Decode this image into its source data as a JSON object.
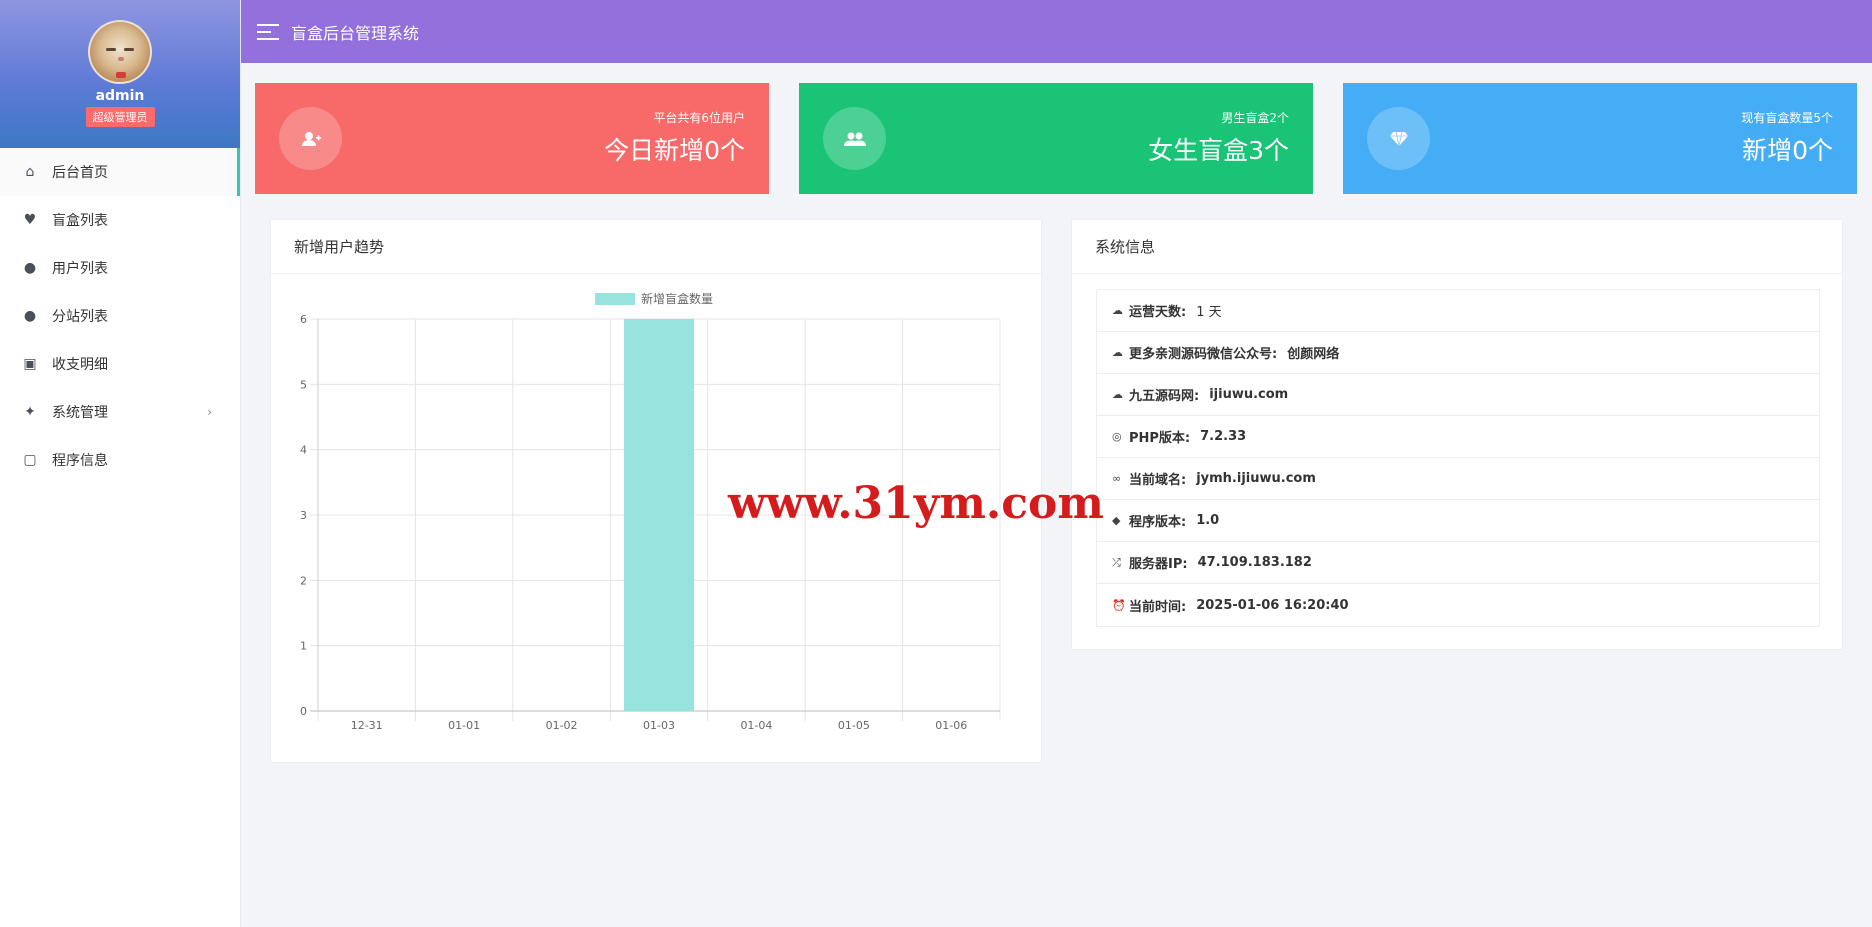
{
  "sidebar": {
    "user_name": "admin",
    "role_badge": "超级管理员",
    "items": [
      {
        "label": "后台首页",
        "icon": "home-icon",
        "glyph": "⌂",
        "active": true
      },
      {
        "label": "盲盒列表",
        "icon": "heart-icon",
        "glyph": "♥"
      },
      {
        "label": "用户列表",
        "icon": "user-icon",
        "glyph": "●"
      },
      {
        "label": "分站列表",
        "icon": "user-icon",
        "glyph": "●"
      },
      {
        "label": "收支明细",
        "icon": "contacts-book-icon",
        "glyph": "▣"
      },
      {
        "label": "系统管理",
        "icon": "sparkles-icon",
        "glyph": "✦",
        "has_submenu": true
      },
      {
        "label": "程序信息",
        "icon": "terminal-icon",
        "glyph": "▢"
      }
    ],
    "submenu_arrow": "›"
  },
  "header": {
    "title": "盲盒后台管理系统",
    "bg_color": "#9370db"
  },
  "cards": [
    {
      "small": "平台共有6位用户",
      "big": "今日新增0个",
      "icon": "user-plus-icon",
      "color": "#f86a6a"
    },
    {
      "small": "男生盲盒2个",
      "big": "女生盲盒3个",
      "icon": "users-icon",
      "color": "#1bc377"
    },
    {
      "small": "现有盲盒数量5个",
      "big": "新增0个",
      "icon": "diamond-icon",
      "color": "#45adf5"
    }
  ],
  "chart_panel": {
    "title": "新增用户趋势"
  },
  "chart_data": {
    "type": "bar",
    "categories": [
      "12-31",
      "01-01",
      "01-02",
      "01-03",
      "01-04",
      "01-05",
      "01-06"
    ],
    "series": [
      {
        "name": "新增盲盒数量",
        "values": [
          0,
          0,
          0,
          6,
          0,
          0,
          0
        ],
        "color": "#98e3dd"
      }
    ],
    "ylim": [
      0,
      6
    ],
    "yticks": [
      0,
      1,
      2,
      3,
      4,
      5,
      6
    ],
    "legend": "top-center",
    "grid": true
  },
  "info_panel": {
    "title": "系统信息",
    "rows": [
      {
        "icon": "cloud-icon",
        "glyph": "☁",
        "label": "运营天数:",
        "value": "1 天",
        "light": true
      },
      {
        "icon": "cloud-icon",
        "glyph": "☁",
        "label": "更多亲测源码微信公众号:",
        "value": "创颜网络"
      },
      {
        "icon": "cloud-icon",
        "glyph": "☁",
        "label": "九五源码网:",
        "value": "ijiuwu.com"
      },
      {
        "icon": "php-icon",
        "glyph": "◎",
        "label": "PHP版本:",
        "value": "7.2.33"
      },
      {
        "icon": "link-icon",
        "glyph": "∞",
        "label": "当前域名:",
        "value": "jymh.ijiuwu.com"
      },
      {
        "icon": "code-icon",
        "glyph": "◆",
        "label": "程序版本:",
        "value": "1.0"
      },
      {
        "icon": "shuffle-icon",
        "glyph": "⤮",
        "label": "服务器IP:",
        "value": "47.109.183.182"
      },
      {
        "icon": "alarm-clock-icon",
        "glyph": "⏰",
        "label": "当前时间:",
        "value": "2025-01-06 16:20:40"
      }
    ]
  },
  "watermark": "www.31ym.com"
}
